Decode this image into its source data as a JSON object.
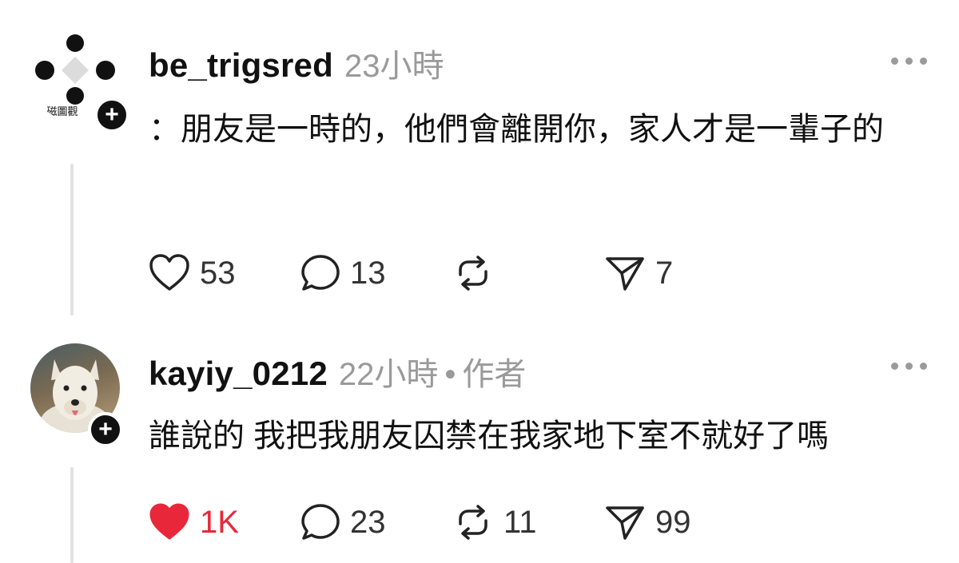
{
  "posts": [
    {
      "username": "be_trigsred",
      "time": "23小時",
      "is_author": false,
      "text": "：朋友是一時的，他們會離開你，家人才是一輩子的",
      "avatar_logo_text": "磁圖觀",
      "actions": {
        "likes": "53",
        "replies": "13",
        "reposts": "",
        "shares": "7",
        "liked": false
      }
    },
    {
      "username": "kayiy_0212",
      "time": "22小時",
      "separator": "•",
      "author_tag": "作者",
      "is_author": true,
      "text": "誰說的 我把我朋友囚禁在我家地下室不就好了嗎",
      "actions": {
        "likes": "1K",
        "replies": "23",
        "reposts": "11",
        "shares": "99",
        "liked": true
      }
    }
  ],
  "icons": {
    "like": "heart-icon",
    "reply": "speech-bubble-icon",
    "repost": "repost-arrows-icon",
    "share": "paper-plane-icon",
    "more": "ellipsis-icon",
    "follow": "plus-icon"
  },
  "colors": {
    "like_active": "#e8283a",
    "muted": "#9a9a9a",
    "text": "#111111",
    "thread_line": "#e2e2e2"
  }
}
